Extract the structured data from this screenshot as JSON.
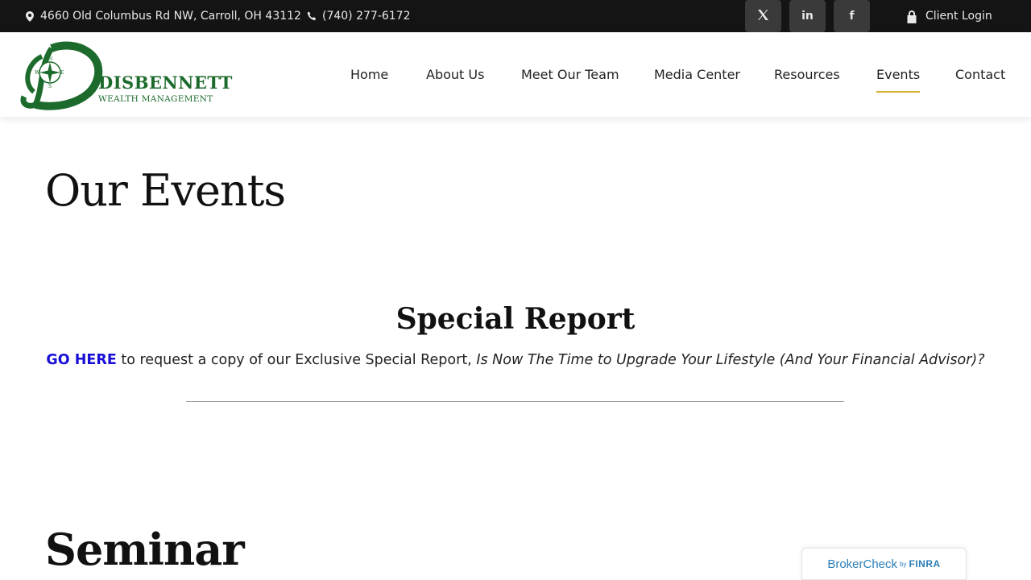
{
  "topbar": {
    "address": "4660 Old Columbus Rd NW, Carroll, OH 43112",
    "phone": "(740) 277-6172",
    "social": [
      {
        "icon": "x-twitter-icon",
        "label": "𝕏"
      },
      {
        "icon": "linkedin-icon",
        "label": "in"
      },
      {
        "icon": "facebook-icon",
        "label": "f"
      }
    ],
    "client_login": "Client Login"
  },
  "logo": {
    "name": "DISBENNETT",
    "subtitle": "WEALTH MANAGEMENT",
    "compass_letters": [
      "N",
      "E",
      "S",
      "W"
    ],
    "brand_color": "#1c6b2c"
  },
  "nav": {
    "items": [
      {
        "label": "Home"
      },
      {
        "label": "About Us"
      },
      {
        "label": "Meet Our Team"
      },
      {
        "label": "Media Center"
      },
      {
        "label": "Resources"
      },
      {
        "label": "Events",
        "active": true
      },
      {
        "label": "Contact"
      }
    ],
    "active_underline_color": "#d4b133"
  },
  "page": {
    "title": "Our Events",
    "special_report": {
      "heading": "Special Report",
      "link_text": "GO HERE",
      "body_text": " to request a copy of our Exclusive Special Report, ",
      "report_title": "Is Now The Time to Upgrade Your Lifestyle (And Your Financial Advisor)?"
    },
    "seminar_heading": "Seminar"
  },
  "brokercheck": {
    "main": "BrokerCheck",
    "by": "by",
    "finra": "FINRA"
  }
}
